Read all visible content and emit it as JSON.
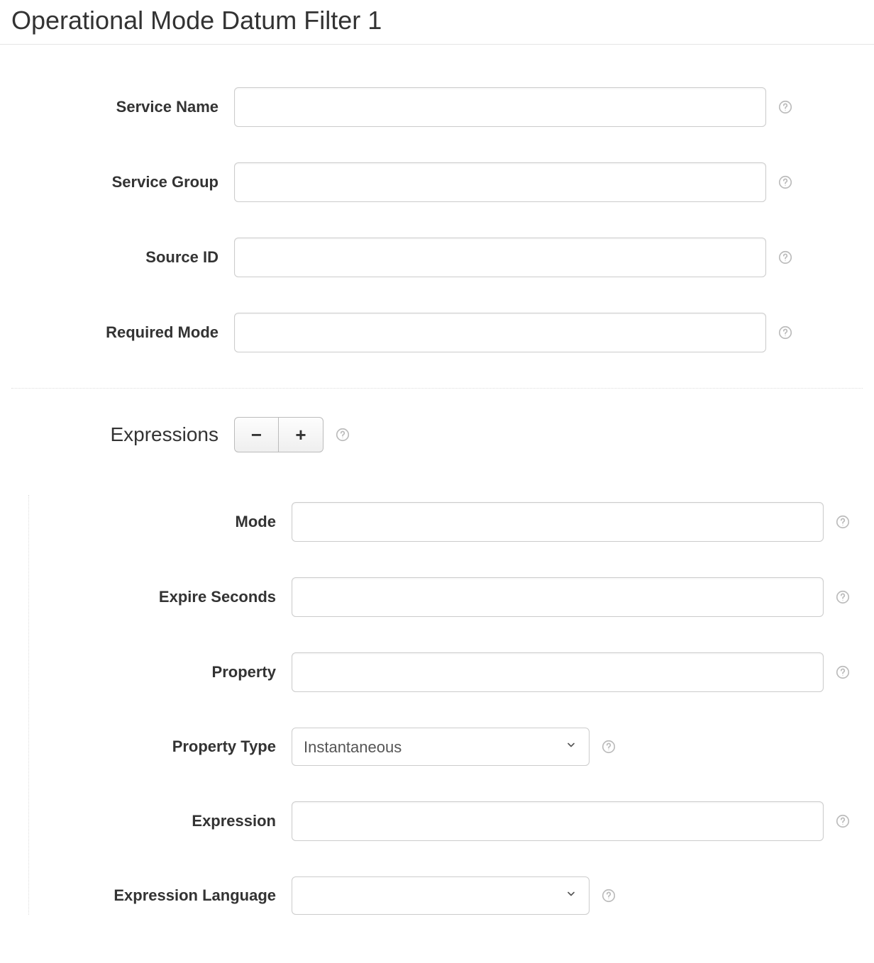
{
  "title": "Operational Mode Datum Filter 1",
  "fields": {
    "service_name": {
      "label": "Service Name",
      "value": ""
    },
    "service_group": {
      "label": "Service Group",
      "value": ""
    },
    "source_id": {
      "label": "Source ID",
      "value": ""
    },
    "required_mode": {
      "label": "Required Mode",
      "value": ""
    }
  },
  "expressions": {
    "label": "Expressions",
    "items": [
      {
        "mode": {
          "label": "Mode",
          "value": ""
        },
        "expire_seconds": {
          "label": "Expire Seconds",
          "value": ""
        },
        "property": {
          "label": "Property",
          "value": ""
        },
        "property_type": {
          "label": "Property Type",
          "selected": "Instantaneous"
        },
        "expression": {
          "label": "Expression",
          "value": ""
        },
        "expression_language": {
          "label": "Expression Language",
          "selected": ""
        }
      }
    ]
  },
  "buttons": {
    "remove": "−",
    "add": "+"
  }
}
